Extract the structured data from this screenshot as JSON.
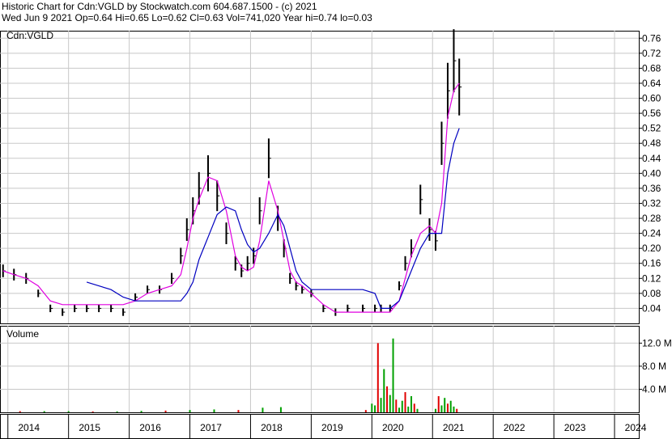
{
  "header": {
    "line1": "Historic Chart for Cdn:VGLD by Stockwatch.com 604.687.1500 - (c) 2021",
    "line2": "Wed Jun  9 2021  Op=0.64  Hi=0.65  Lo=0.62  Cl=0.63  Vol=741,020  Year hi=0.74  lo=0.03"
  },
  "colors": {
    "background": "#ffffff",
    "grid": "#c8c8c8",
    "price_bars": "#000000",
    "short_ma": "#e000e0",
    "long_ma": "#0000c0",
    "volume_up": "#00a000",
    "volume_down": "#e00000"
  },
  "chart_data": [
    {
      "type": "line",
      "panel": "price",
      "title": "Cdn:VGLD",
      "ylim": [
        0.0,
        0.78
      ],
      "yticks": [
        0.04,
        0.08,
        0.12,
        0.16,
        0.2,
        0.24,
        0.28,
        0.32,
        0.36,
        0.4,
        0.44,
        0.48,
        0.52,
        0.56,
        0.6,
        0.64,
        0.68,
        0.72,
        0.76
      ],
      "ytick_labels": [
        "0.04",
        "0.08",
        "0.12",
        "0.16",
        "0.20",
        "0.24",
        "0.28",
        "0.32",
        "0.36",
        "0.40",
        "0.44",
        "0.48",
        "0.52",
        "0.56",
        "0.60",
        "0.64",
        "0.68",
        "0.72",
        "0.76"
      ],
      "x": [
        2013.92,
        2014.1,
        2014.3,
        2014.5,
        2014.7,
        2014.9,
        2015.1,
        2015.3,
        2015.5,
        2015.7,
        2015.9,
        2016.1,
        2016.3,
        2016.5,
        2016.7,
        2016.85,
        2016.95,
        2017.05,
        2017.15,
        2017.3,
        2017.45,
        2017.6,
        2017.75,
        2017.85,
        2017.95,
        2018.05,
        2018.15,
        2018.3,
        2018.45,
        2018.55,
        2018.65,
        2018.75,
        2018.85,
        2019.0,
        2019.2,
        2019.4,
        2019.6,
        2019.85,
        2020.05,
        2020.15,
        2020.3,
        2020.45,
        2020.55,
        2020.65,
        2020.8,
        2020.95,
        2021.05,
        2021.15,
        2021.25,
        2021.35,
        2021.44
      ],
      "series": [
        {
          "name": "price",
          "values": [
            0.14,
            0.13,
            0.12,
            0.08,
            0.04,
            0.03,
            0.04,
            0.04,
            0.04,
            0.04,
            0.03,
            0.07,
            0.09,
            0.09,
            0.12,
            0.18,
            0.25,
            0.3,
            0.36,
            0.4,
            0.34,
            0.24,
            0.16,
            0.14,
            0.16,
            0.18,
            0.3,
            0.44,
            0.28,
            0.2,
            0.12,
            0.1,
            0.09,
            0.08,
            0.04,
            0.03,
            0.04,
            0.04,
            0.04,
            0.04,
            0.04,
            0.1,
            0.16,
            0.2,
            0.33,
            0.25,
            0.22,
            0.48,
            0.62,
            0.7,
            0.63
          ]
        },
        {
          "name": "short-ma",
          "values": [
            0.14,
            0.13,
            0.12,
            0.1,
            0.06,
            0.05,
            0.05,
            0.05,
            0.05,
            0.05,
            0.05,
            0.06,
            0.08,
            0.09,
            0.1,
            0.13,
            0.2,
            0.28,
            0.33,
            0.39,
            0.38,
            0.3,
            0.18,
            0.15,
            0.14,
            0.15,
            0.22,
            0.38,
            0.3,
            0.22,
            0.14,
            0.11,
            0.1,
            0.08,
            0.05,
            0.03,
            0.03,
            0.03,
            0.03,
            0.03,
            0.03,
            0.06,
            0.12,
            0.18,
            0.24,
            0.26,
            0.24,
            0.32,
            0.55,
            0.62,
            0.64
          ]
        },
        {
          "name": "long-ma",
          "values": [
            null,
            null,
            null,
            null,
            null,
            null,
            null,
            0.11,
            0.1,
            0.09,
            0.07,
            0.06,
            0.06,
            0.06,
            0.06,
            0.06,
            0.08,
            0.11,
            0.17,
            0.23,
            0.29,
            0.31,
            0.3,
            0.25,
            0.21,
            0.19,
            0.2,
            0.24,
            0.29,
            0.26,
            0.2,
            0.14,
            0.11,
            0.09,
            0.09,
            0.09,
            0.09,
            0.09,
            0.08,
            0.04,
            0.04,
            0.06,
            0.1,
            0.14,
            0.2,
            0.24,
            0.24,
            0.24,
            0.4,
            0.48,
            0.52
          ]
        }
      ]
    },
    {
      "type": "bar",
      "panel": "volume",
      "title": "Volume",
      "ylim": [
        0,
        15000000
      ],
      "yticks": [
        4000000,
        8000000,
        12000000
      ],
      "ytick_labels": [
        "4.0 M",
        "8.0 M",
        "12.0 M"
      ],
      "x": [
        2014.2,
        2014.6,
        2015.0,
        2015.4,
        2015.8,
        2016.2,
        2016.6,
        2017.0,
        2017.4,
        2017.8,
        2018.2,
        2018.5,
        2019.9,
        2020.0,
        2020.05,
        2020.1,
        2020.15,
        2020.2,
        2020.25,
        2020.3,
        2020.35,
        2020.4,
        2020.45,
        2020.5,
        2020.55,
        2020.6,
        2020.65,
        2020.7,
        2020.75,
        2021.05,
        2021.1,
        2021.15,
        2021.2,
        2021.25,
        2021.3,
        2021.35,
        2021.4
      ],
      "series": [
        {
          "name": "volume",
          "values": [
            200000,
            200000,
            200000,
            150000,
            150000,
            250000,
            300000,
            400000,
            500000,
            400000,
            800000,
            900000,
            400000,
            1500000,
            1200000,
            12000000,
            2500000,
            7500000,
            4500000,
            3000000,
            12800000,
            2200000,
            800000,
            2000000,
            3500000,
            1000000,
            2800000,
            1500000,
            600000,
            600000,
            2800000,
            1200000,
            2500000,
            1500000,
            2000000,
            1000000,
            600000
          ]
        }
      ]
    }
  ],
  "xaxis": {
    "years": [
      "2014",
      "2015",
      "2016",
      "2017",
      "2018",
      "2019",
      "2020",
      "2021",
      "2022",
      "2023",
      "2024"
    ]
  }
}
